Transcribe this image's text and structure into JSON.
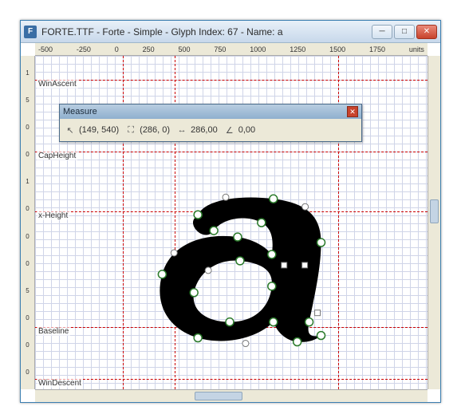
{
  "window": {
    "title": "FORTE.TTF - Forte - Simple - Glyph Index: 67 - Name: a"
  },
  "ruler_h": {
    "ticks": [
      "-500",
      "-250",
      "0",
      "250",
      "500",
      "750",
      "1000",
      "1250",
      "1500",
      "1750"
    ],
    "units": "units"
  },
  "ruler_v": {
    "ticks": [
      "1",
      "5",
      "0",
      "0",
      "1",
      "0",
      "0",
      "0",
      "5",
      "0",
      "0",
      "0"
    ]
  },
  "metrics": {
    "winascent": "WinAscent",
    "capheight": "CapHeight",
    "xheight": "x-Height",
    "baseline": "Baseline",
    "windescent": "WinDescent"
  },
  "measure": {
    "title": "Measure",
    "point1": "(149, 540)",
    "point2": "(286, 0)",
    "distance": "286,00",
    "angle": "0,00"
  }
}
